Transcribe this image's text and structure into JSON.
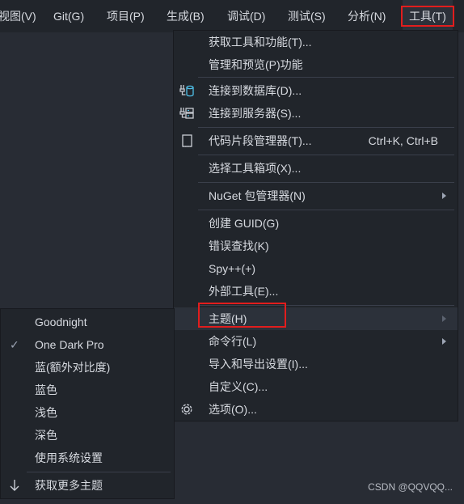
{
  "menubar": {
    "items": [
      {
        "label": "视图(V)"
      },
      {
        "label": "Git(G)"
      },
      {
        "label": "项目(P)"
      },
      {
        "label": "生成(B)"
      },
      {
        "label": "调试(D)"
      },
      {
        "label": "测试(S)"
      },
      {
        "label": "分析(N)"
      },
      {
        "label": "工具(T)"
      }
    ]
  },
  "tools_menu": {
    "items": [
      {
        "label": "获取工具和功能(T)..."
      },
      {
        "label": "管理和预览(P)功能"
      },
      {
        "label": "连接到数据库(D)...",
        "icon": "database-connect-icon"
      },
      {
        "label": "连接到服务器(S)...",
        "icon": "server-connect-icon"
      },
      {
        "label": "代码片段管理器(T)...",
        "shortcut": "Ctrl+K, Ctrl+B",
        "icon": "snippet-icon"
      },
      {
        "label": "选择工具箱项(X)..."
      },
      {
        "label": "NuGet 包管理器(N)"
      },
      {
        "label": "创建 GUID(G)"
      },
      {
        "label": "错误查找(K)"
      },
      {
        "label": "Spy++(+)"
      },
      {
        "label": "外部工具(E)..."
      },
      {
        "label": "主题(H)"
      },
      {
        "label": "命令行(L)"
      },
      {
        "label": "导入和导出设置(I)..."
      },
      {
        "label": "自定义(C)..."
      },
      {
        "label": "选项(O)...",
        "icon": "gear-icon"
      }
    ]
  },
  "theme_menu": {
    "items": [
      {
        "label": "Goodnight"
      },
      {
        "label": "One Dark Pro",
        "checked": true
      },
      {
        "label": "蓝(额外对比度)"
      },
      {
        "label": "蓝色"
      },
      {
        "label": "浅色"
      },
      {
        "label": "深色"
      },
      {
        "label": "使用系统设置"
      },
      {
        "label": "获取更多主题",
        "icon": "download-arrow-icon"
      }
    ],
    "check_glyph": "✓"
  },
  "watermark": "CSDN @QQVQQ...",
  "colors": {
    "background": "#282c34",
    "menu": "#21252b",
    "text": "#d7dae0",
    "highlight_border": "#e21d1d",
    "icon_accent": "#4fc1e9"
  }
}
